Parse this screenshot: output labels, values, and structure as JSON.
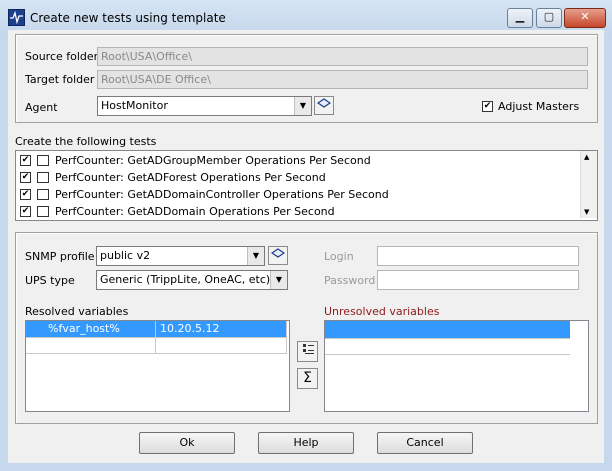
{
  "window": {
    "title": "Create new tests using template"
  },
  "source": {
    "label": "Source folder",
    "value": "Root\\USA\\Office\\"
  },
  "target": {
    "label": "Target folder",
    "value": "Root\\USA\\DE Office\\"
  },
  "agent": {
    "label": "Agent",
    "value": "HostMonitor"
  },
  "adjust_masters": {
    "label": "Adjust Masters",
    "checked": true
  },
  "tests": {
    "label": "Create the following tests",
    "items": [
      "PerfCounter: GetADGroupMember Operations Per Second",
      "PerfCounter: GetADForest Operations Per Second",
      "PerfCounter: GetADDomainController Operations Per Second",
      "PerfCounter: GetADDomain Operations Per Second"
    ]
  },
  "snmp": {
    "label": "SNMP profile",
    "value": "public v2"
  },
  "ups": {
    "label": "UPS type",
    "value": "Generic (TrippLite, OneAC, etc)"
  },
  "login": {
    "label": "Login",
    "value": ""
  },
  "password": {
    "label": "Password",
    "value": ""
  },
  "resolved": {
    "label": "Resolved variables",
    "rows": [
      {
        "name": "%fvar_host%",
        "value": "10.20.5.12"
      }
    ]
  },
  "unresolved": {
    "label": "Unresolved variables"
  },
  "buttons": {
    "ok": "Ok",
    "help": "Help",
    "cancel": "Cancel"
  },
  "colors": {
    "selection": "#3399ff",
    "unresolved_label": "#8b1a1a"
  }
}
